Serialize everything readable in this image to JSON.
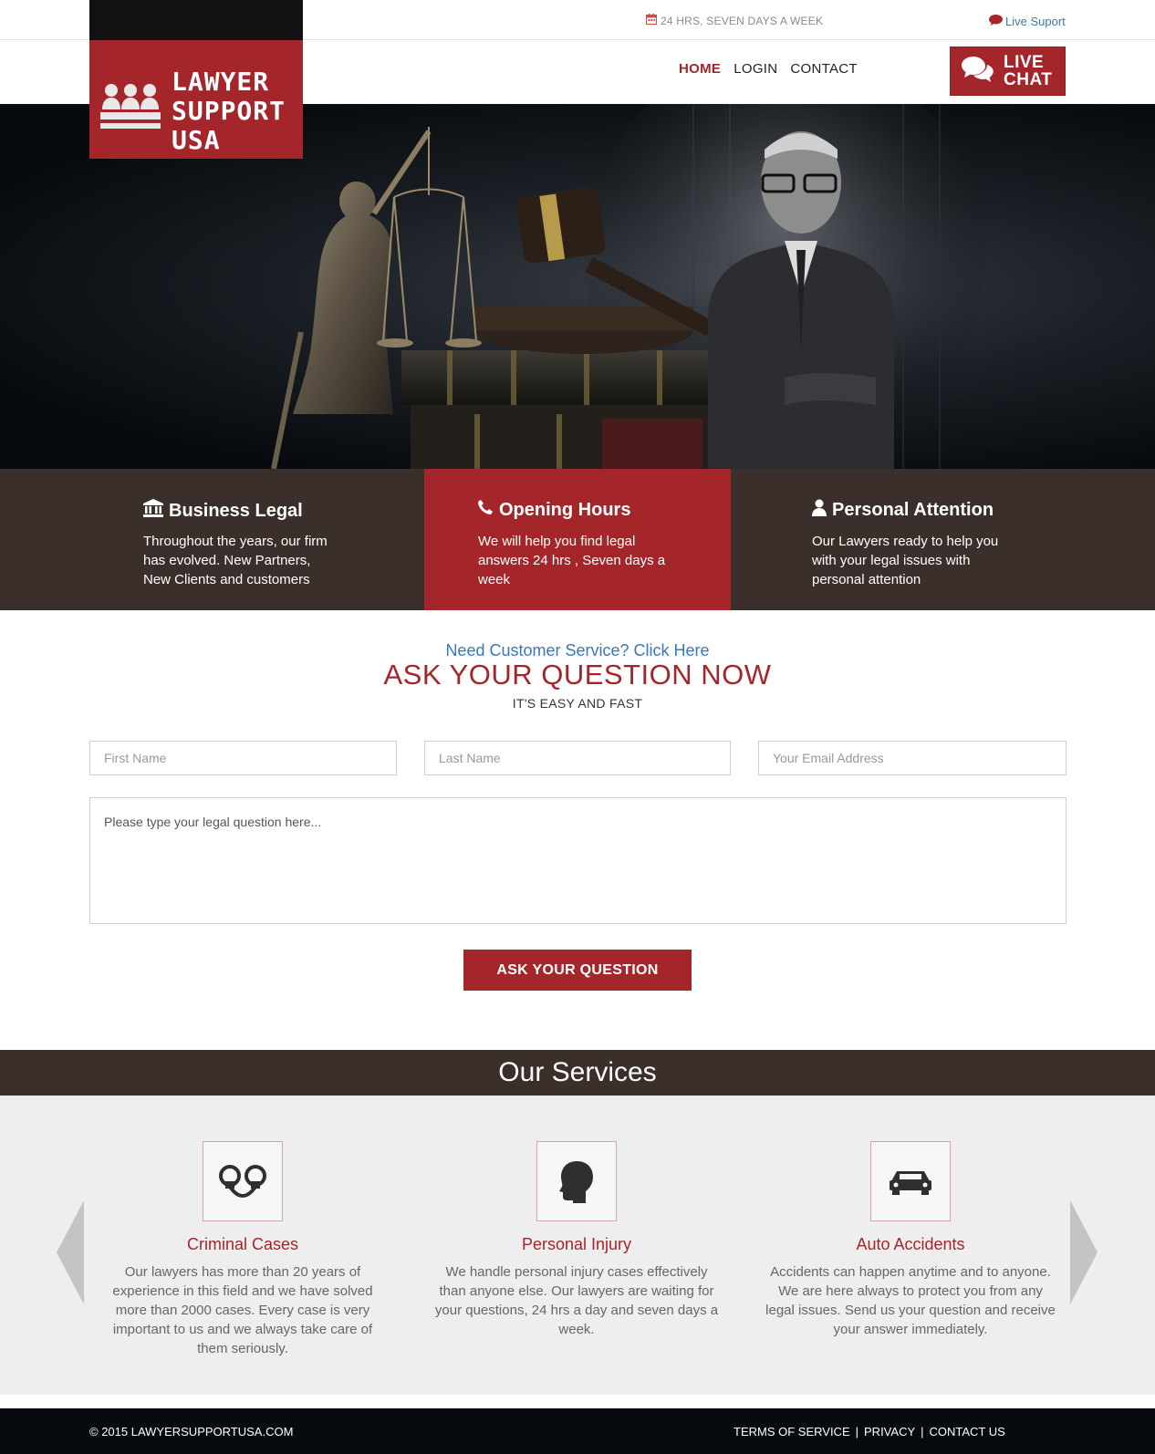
{
  "topbar": {
    "hours": "24 HRS, SEVEN DAYS A WEEK",
    "live_support": "Live Suport"
  },
  "logo": {
    "line1": "LAWYER",
    "line2": "SUPPORT",
    "line3": "USA"
  },
  "nav": {
    "home": "HOME",
    "login": "LOGIN",
    "contact": "CONTACT"
  },
  "live_chat": {
    "line1": "LIVE",
    "line2": "CHAT"
  },
  "features": [
    {
      "icon": "bank-icon",
      "title": "Business Legal",
      "lines": [
        "Throughout the years, our firm",
        "has evolved. New Partners,",
        "New Clients and customers"
      ]
    },
    {
      "icon": "phone-icon",
      "title": "Opening Hours",
      "lines": [
        "We will help you find legal",
        "answers 24 hrs , Seven days a",
        "week"
      ]
    },
    {
      "icon": "user-icon",
      "title": "Personal Attention",
      "lines": [
        "Our Lawyers ready to help you",
        "with your legal issues with",
        "personal attention"
      ]
    }
  ],
  "ask": {
    "need_service": "Need Customer Service? Click Here",
    "title": "ASK YOUR QUESTION NOW",
    "subtitle": "IT'S EASY AND FAST",
    "first_name_placeholder": "First Name",
    "last_name_placeholder": "Last Name",
    "email_placeholder": "Your Email Address",
    "question_placeholder": "Please type your legal question here...",
    "button": "ASK YOUR QUESTION"
  },
  "services": {
    "heading": "Our Services",
    "items": [
      {
        "icon": "handcuffs-icon",
        "title": "Criminal Cases",
        "text": "Our lawyers has more than 20 years of experience in this field and we have solved more than 2000 cases. Every case is very important to us and we always take care of them seriously."
      },
      {
        "icon": "head-icon",
        "title": "Personal Injury",
        "text": "We handle personal injury cases effectively than anyone else. Our lawyers are waiting for your questions, 24 hrs a day and seven days a week."
      },
      {
        "icon": "car-icon",
        "title": "Auto Accidents",
        "text": "Accidents can happen anytime and to anyone. We are here always to protect you from any legal issues. Send us your question and receive your answer immediately."
      }
    ]
  },
  "footer": {
    "copyright": "© 2015 LAWYERSUPPORTUSA.COM",
    "terms": "TERMS OF SERVICE",
    "privacy": "PRIVACY",
    "contact": "CONTACT US",
    "separator": "|"
  },
  "colors": {
    "brand_red": "#a4262a",
    "dark_brown": "#3a2f2b",
    "link_blue": "#3a78b4",
    "footer_bg": "#070b0f"
  }
}
